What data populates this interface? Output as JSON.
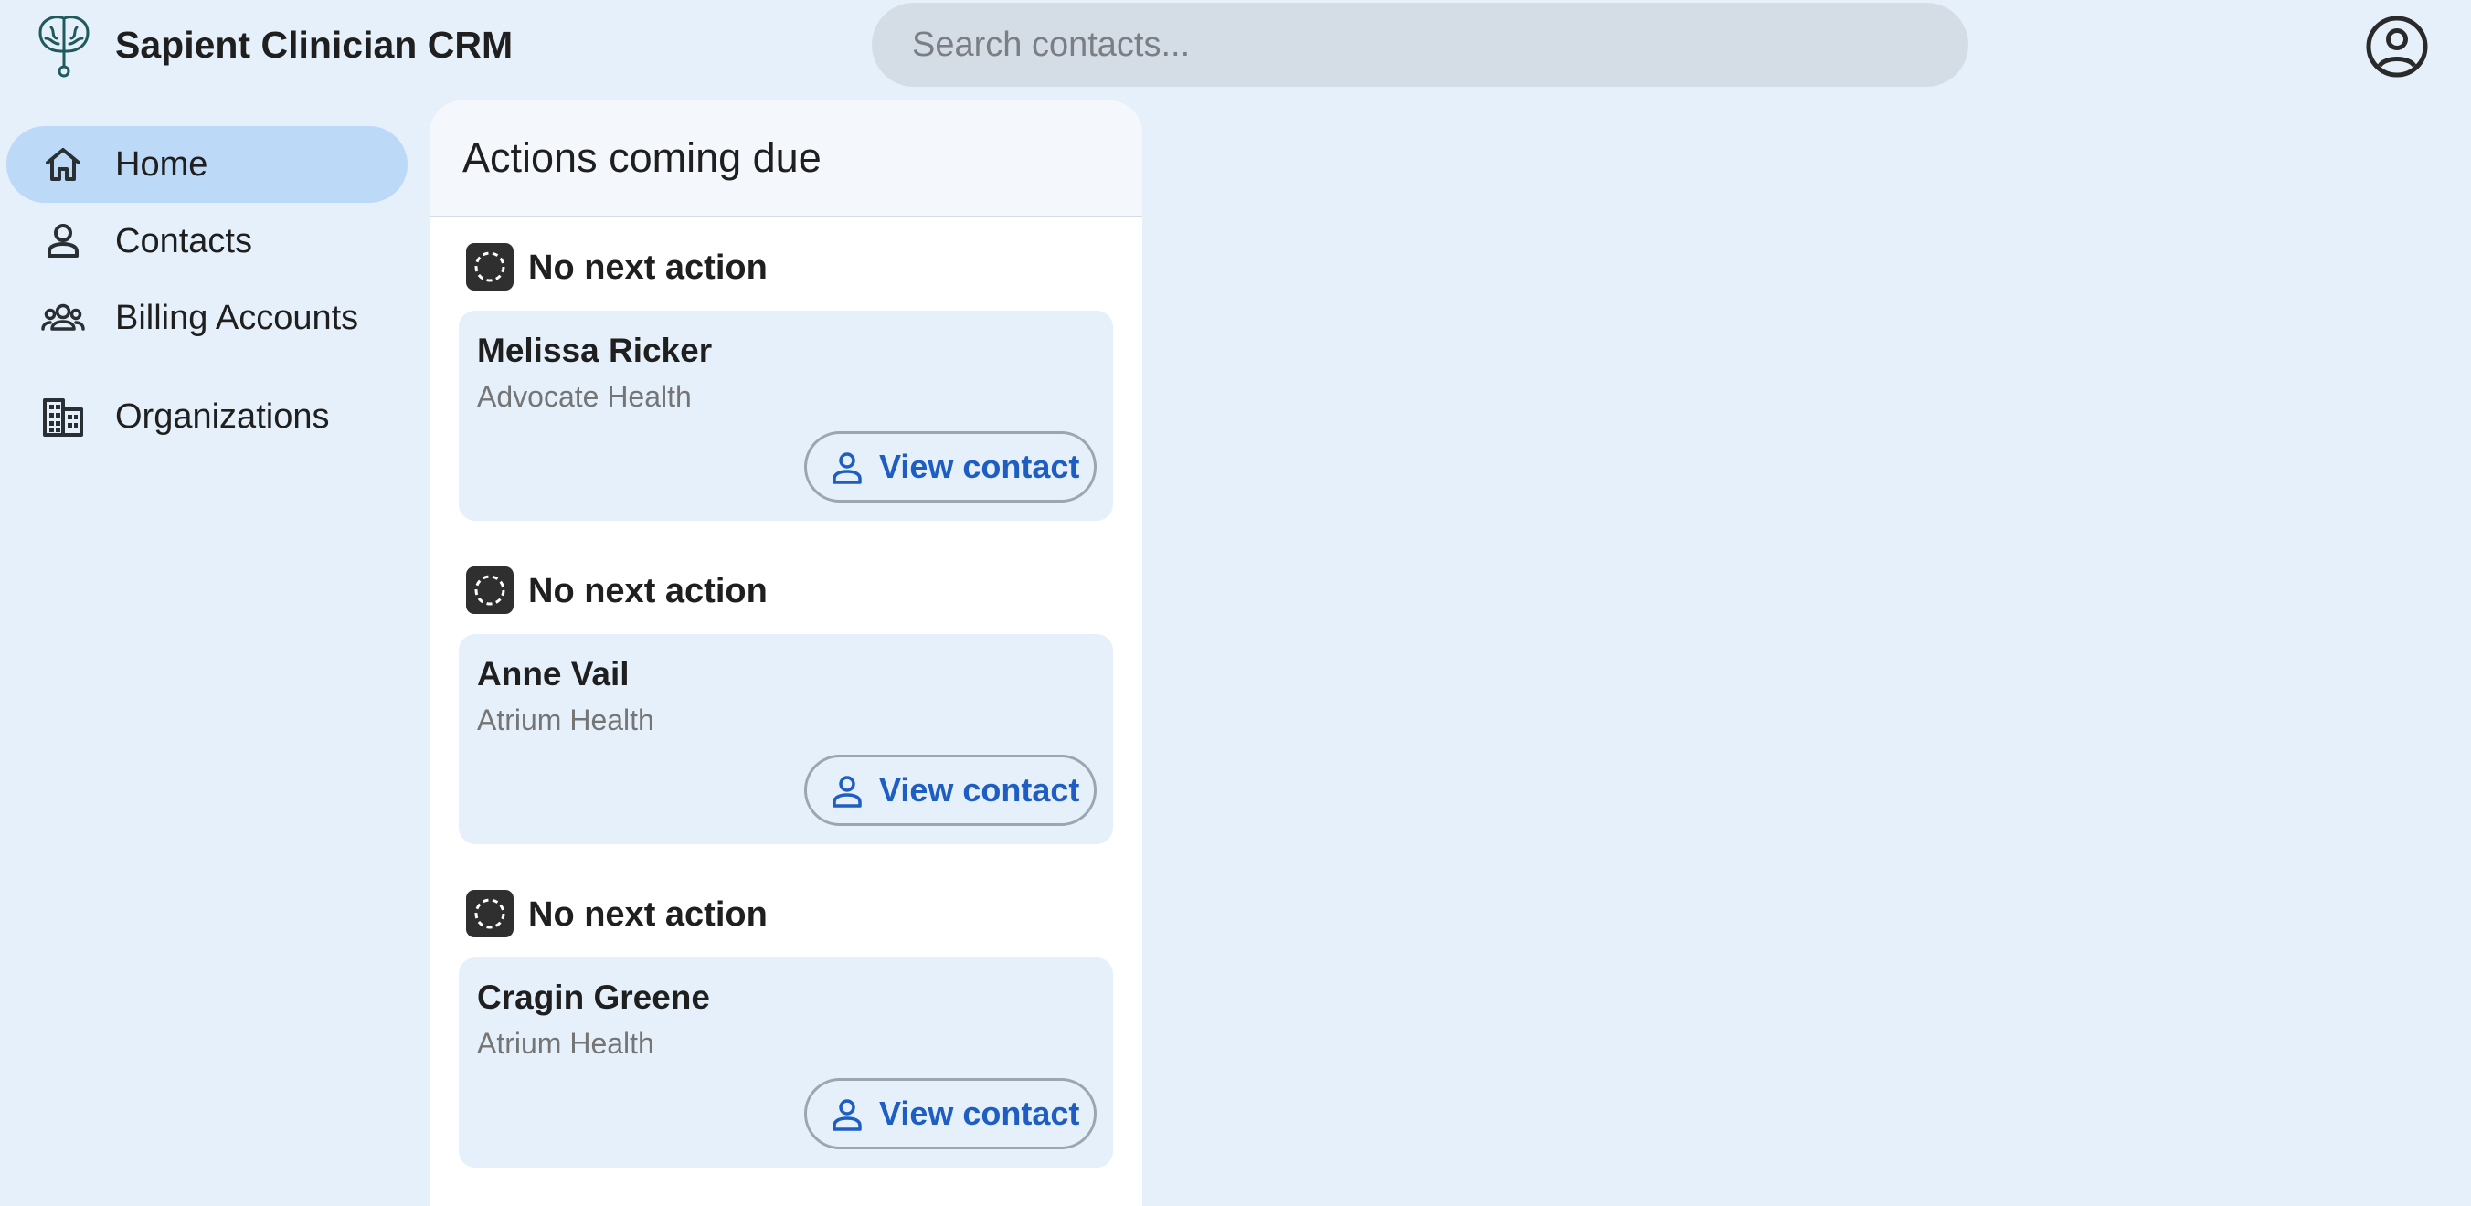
{
  "app": {
    "title": "Sapient Clinician CRM",
    "logo_icon": "brain-stethoscope-icon",
    "account_icon": "account-circle-icon"
  },
  "search": {
    "placeholder": "Search contacts...",
    "value": ""
  },
  "sidebar": {
    "items": [
      {
        "label": "Home",
        "icon": "home-icon",
        "active": true
      },
      {
        "label": "Contacts",
        "icon": "person-icon",
        "active": false
      },
      {
        "label": "Billing Accounts",
        "icon": "group-icon",
        "active": false
      },
      {
        "label": "Organizations",
        "icon": "building-icon",
        "active": false
      }
    ]
  },
  "main": {
    "panel_title": "Actions coming due",
    "actions": [
      {
        "status": "No next action",
        "status_icon": "dashed-circle-icon",
        "contact_name": "Melissa Ricker",
        "organization": "Advocate Health",
        "button_label": "View contact",
        "button_icon": "person-icon"
      },
      {
        "status": "No next action",
        "status_icon": "dashed-circle-icon",
        "contact_name": "Anne Vail",
        "organization": "Atrium Health",
        "button_label": "View contact",
        "button_icon": "person-icon"
      },
      {
        "status": "No next action",
        "status_icon": "dashed-circle-icon",
        "contact_name": "Cragin Greene",
        "organization": "Atrium Health",
        "button_label": "View contact",
        "button_icon": "person-icon"
      }
    ]
  },
  "colors": {
    "background": "#e6f0fa",
    "nav_active": "#bcd9f7",
    "link_blue": "#1e5ec3",
    "logo_teal": "#1f5a5c"
  }
}
